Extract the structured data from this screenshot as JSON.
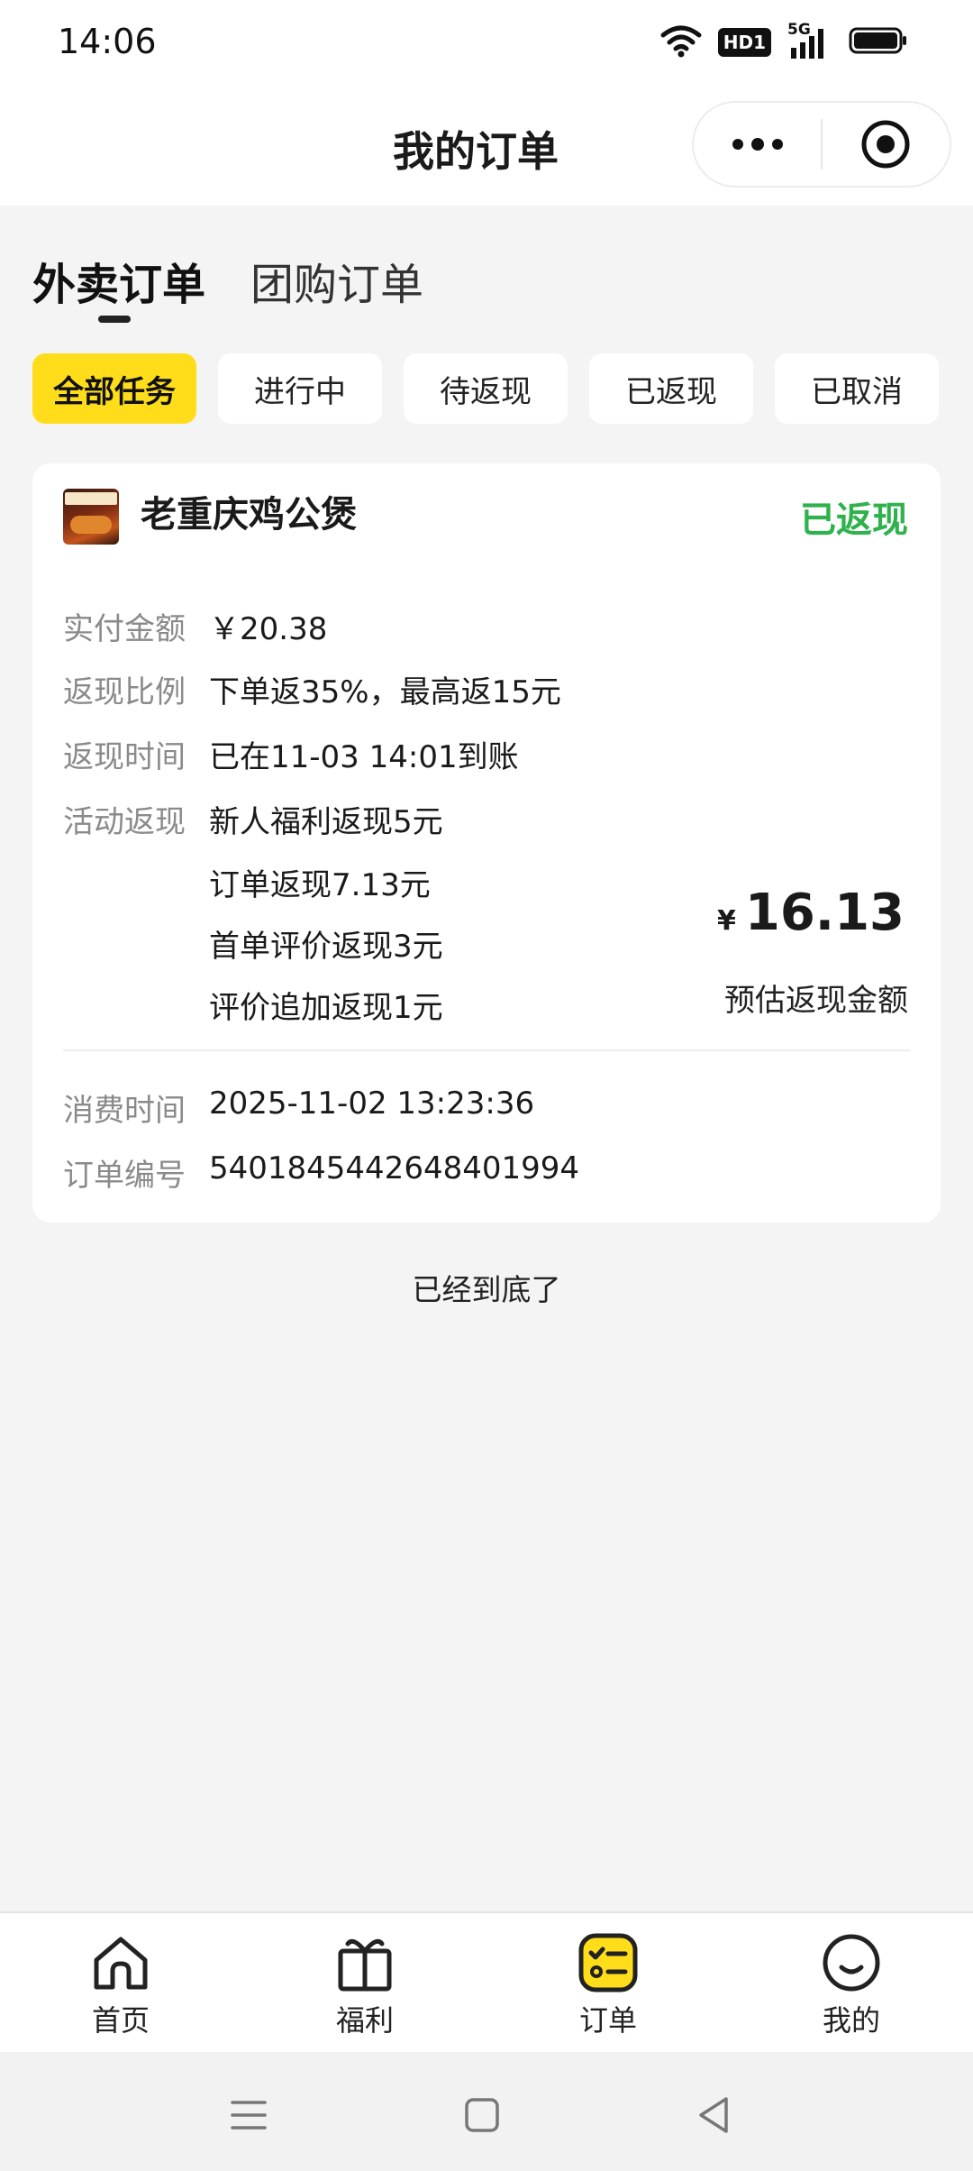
{
  "status_bar": {
    "time": "14:06",
    "hd": "HD1",
    "network": "5G"
  },
  "header": {
    "title": "我的订单"
  },
  "tabs": [
    {
      "label": "外卖订单",
      "active": true
    },
    {
      "label": "团购订单",
      "active": false
    }
  ],
  "filters": [
    {
      "label": "全部任务",
      "active": true
    },
    {
      "label": "进行中",
      "active": false
    },
    {
      "label": "待返现",
      "active": false
    },
    {
      "label": "已返现",
      "active": false
    },
    {
      "label": "已取消",
      "active": false
    }
  ],
  "order": {
    "shop_name": "老重庆鸡公煲",
    "status": "已返现",
    "paid_label": "实付金额",
    "paid_value": "￥20.38",
    "ratio_label": "返现比例",
    "ratio_value": "下单返35%，最高返15元",
    "time_label": "返现时间",
    "time_value": "已在11-03 14:01到账",
    "activity_label": "活动返现",
    "activity_items": [
      "新人福利返现5元",
      "订单返现7.13元",
      "首单评价返现3元",
      "评价追加返现1元"
    ],
    "estimate_currency": "¥",
    "estimate_amount": "16.13",
    "estimate_label": "预估返现金额",
    "consume_label": "消费时间",
    "consume_value": "2025-11-02 13:23:36",
    "order_no_label": "订单编号",
    "order_no_value": "5401845442648401994"
  },
  "end_text": "已经到底了",
  "tabbar": [
    {
      "label": "首页",
      "icon": "home-icon",
      "active": false
    },
    {
      "label": "福利",
      "icon": "gift-icon",
      "active": false
    },
    {
      "label": "订单",
      "icon": "order-list-icon",
      "active": true
    },
    {
      "label": "我的",
      "icon": "profile-icon",
      "active": false
    }
  ],
  "colors": {
    "accent": "#ffdd1a",
    "success": "#2fb24d",
    "background": "#f4f4f4"
  }
}
